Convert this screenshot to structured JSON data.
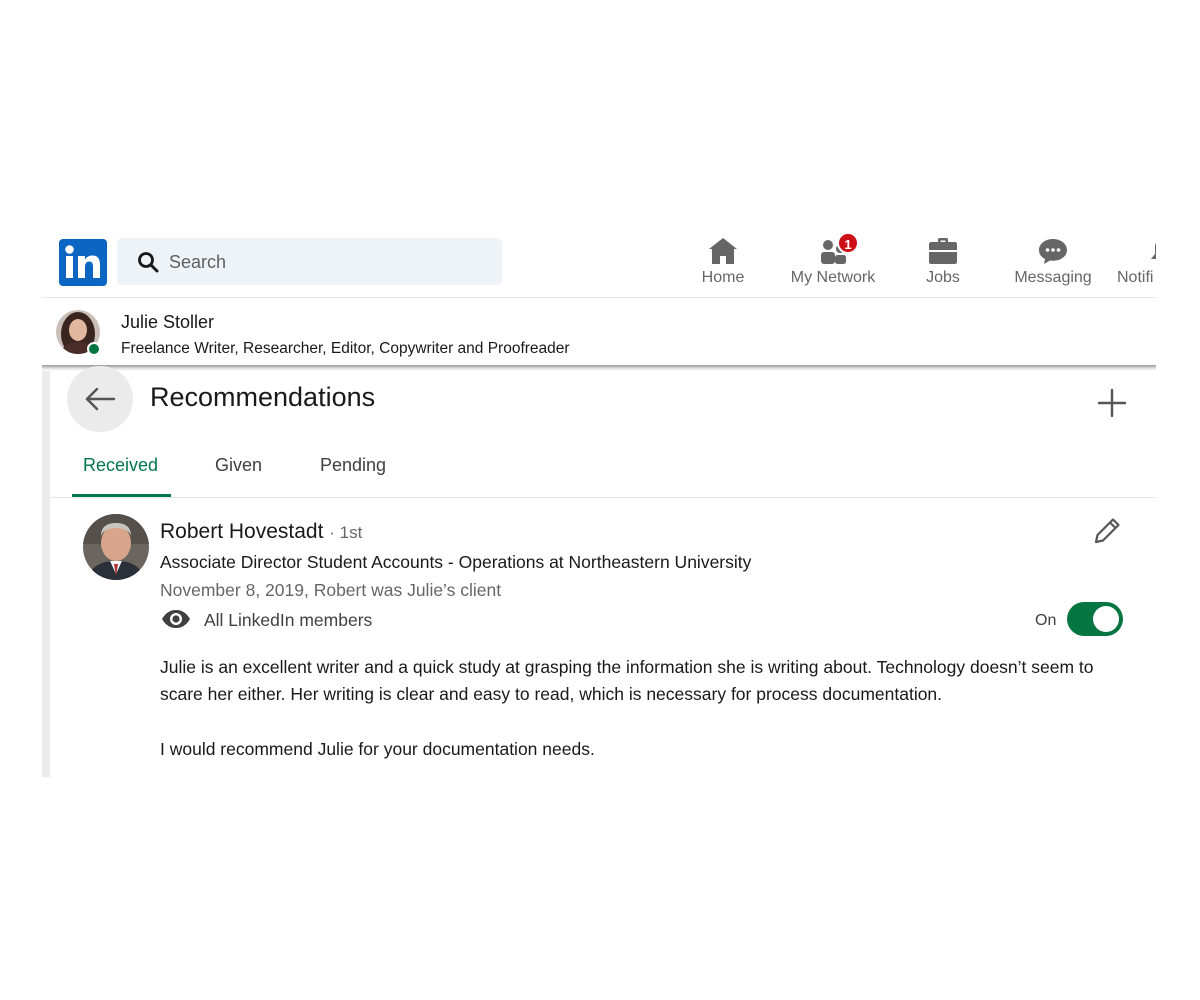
{
  "nav": {
    "search_placeholder": "Search",
    "items": [
      {
        "label": "Home",
        "icon": "home-icon"
      },
      {
        "label": "My Network",
        "icon": "network-icon",
        "badge": "1"
      },
      {
        "label": "Jobs",
        "icon": "briefcase-icon"
      },
      {
        "label": "Messaging",
        "icon": "messaging-icon"
      },
      {
        "label": "Notifi",
        "icon": "bell-icon"
      }
    ]
  },
  "profile": {
    "name": "Julie Stoller",
    "headline": "Freelance Writer, Researcher, Editor, Copywriter and Proofreader"
  },
  "recommendations": {
    "title": "Recommendations",
    "tabs": [
      "Received",
      "Given",
      "Pending"
    ],
    "active_tab": "Received",
    "items": [
      {
        "name": "Robert Hovestadt",
        "degree": "· 1st",
        "title": "Associate Director Student Accounts - Operations at Northeastern University",
        "date_relation": "November 8, 2019, Robert was Julie’s client",
        "visibility": "All LinkedIn members",
        "toggle_label": "On",
        "toggle_on": true,
        "paragraphs": [
          "Julie is an excellent writer and a quick study at grasping the information she is writing about. Technology doesn’t seem to scare her either. Her writing is clear and easy to read, which is necessary for process documentation.",
          "I would recommend Julie for your documentation needs."
        ]
      }
    ]
  },
  "colors": {
    "brand": "#0a66c2",
    "accent_green": "#01754f",
    "badge_red": "#cc1016"
  }
}
